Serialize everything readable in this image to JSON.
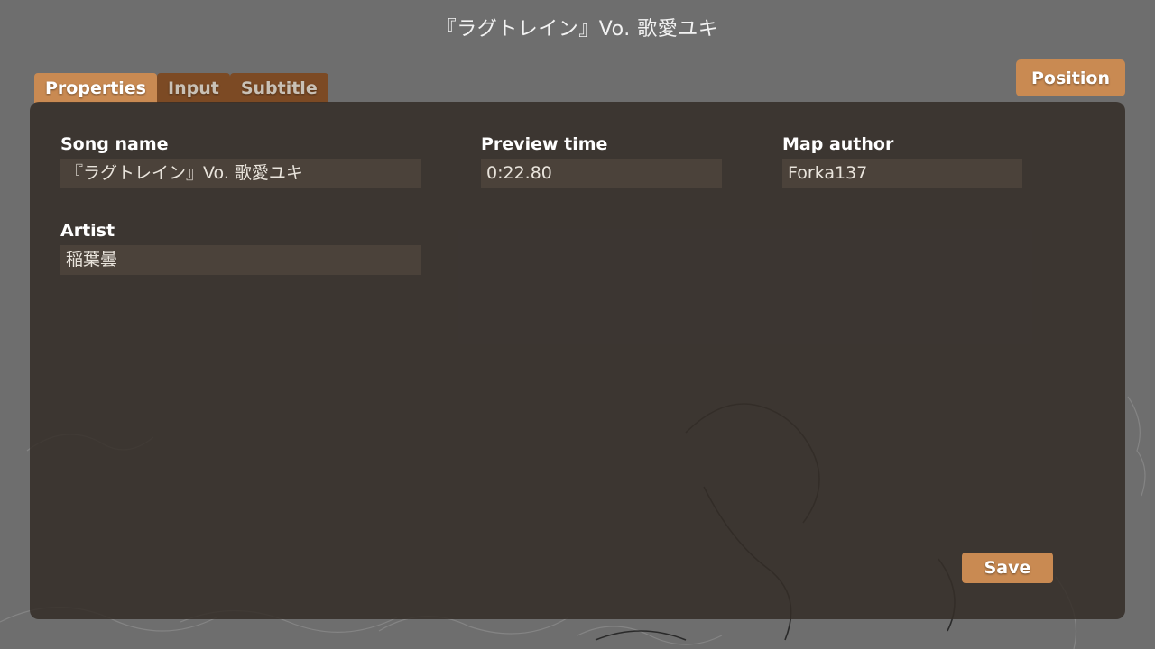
{
  "header": {
    "title": "『ラグトレイン』Vo. 歌愛ユキ"
  },
  "tabs": [
    {
      "label": "Properties",
      "active": true
    },
    {
      "label": "Input",
      "active": false
    },
    {
      "label": "Subtitle",
      "active": false
    }
  ],
  "position_button": {
    "label": "Position"
  },
  "fields": {
    "song_name": {
      "label": "Song name",
      "value": "『ラグトレイン』Vo. 歌愛ユキ"
    },
    "preview_time": {
      "label": "Preview time",
      "value": "0:22.80"
    },
    "map_author": {
      "label": "Map author",
      "value": "Forka137"
    },
    "artist": {
      "label": "Artist",
      "value": "稲葉曇"
    }
  },
  "save_button": {
    "label": "Save"
  },
  "colors": {
    "accent": "#c98a52",
    "tab_inactive": "#7c4a24",
    "panel": "#342d28",
    "input_bg": "#4b423a",
    "background": "#6e6e6e"
  }
}
